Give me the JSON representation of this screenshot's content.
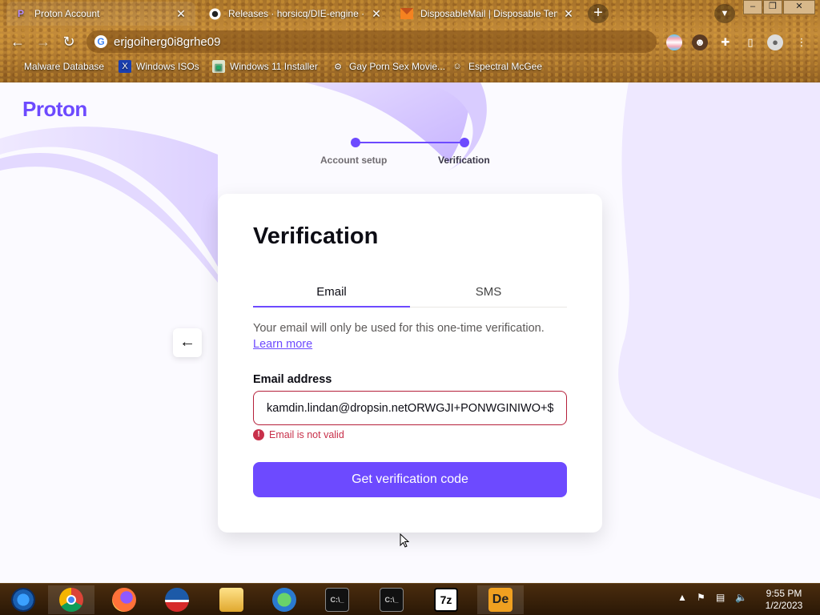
{
  "browser": {
    "tabs": [
      {
        "title": "Proton Account",
        "active": true
      },
      {
        "title": "Releases · horsicq/DIE-engine · G",
        "active": false
      },
      {
        "title": "DisposableMail | Disposable Temp",
        "active": false
      }
    ],
    "url": "erjgoiherg0i8grhe09",
    "bookmarks": [
      {
        "label": "Malware Database"
      },
      {
        "label": "Windows ISOs"
      },
      {
        "label": "Windows 11 Installer"
      },
      {
        "label": "Gay Porn Sex Movie..."
      },
      {
        "label": "Espectral McGee"
      }
    ],
    "icons": {
      "back": "back-arrow-icon",
      "forward": "forward-arrow-icon",
      "reload": "reload-icon",
      "extensions": "puzzle-icon",
      "profile": "profile-icon",
      "menu": "kebab-menu-icon"
    }
  },
  "page": {
    "logo": "Proton",
    "steps": [
      {
        "label": "Account setup"
      },
      {
        "label": "Verification"
      }
    ],
    "card": {
      "title": "Verification",
      "tabs": [
        {
          "label": "Email",
          "selected": true
        },
        {
          "label": "SMS",
          "selected": false
        }
      ],
      "info_text": "Your email will only be used for this one-time verification.",
      "learn_more": "Learn more",
      "email_label": "Email address",
      "email_value": "kamdin.lindan@dropsin.netORWGJI+PONWGINIWO+$E",
      "error_text": "Email is not valid",
      "button_label": "Get verification code"
    },
    "colors": {
      "brand": "#6d4aff",
      "error": "#c8304a"
    }
  },
  "taskbar": {
    "apps": [
      "start-orb",
      "chrome",
      "firefox",
      "obama",
      "file-explorer",
      "network",
      "cmd",
      "cmd",
      "7z",
      "die"
    ],
    "clock_time": "9:55 PM",
    "clock_date": "1/2/2023"
  }
}
